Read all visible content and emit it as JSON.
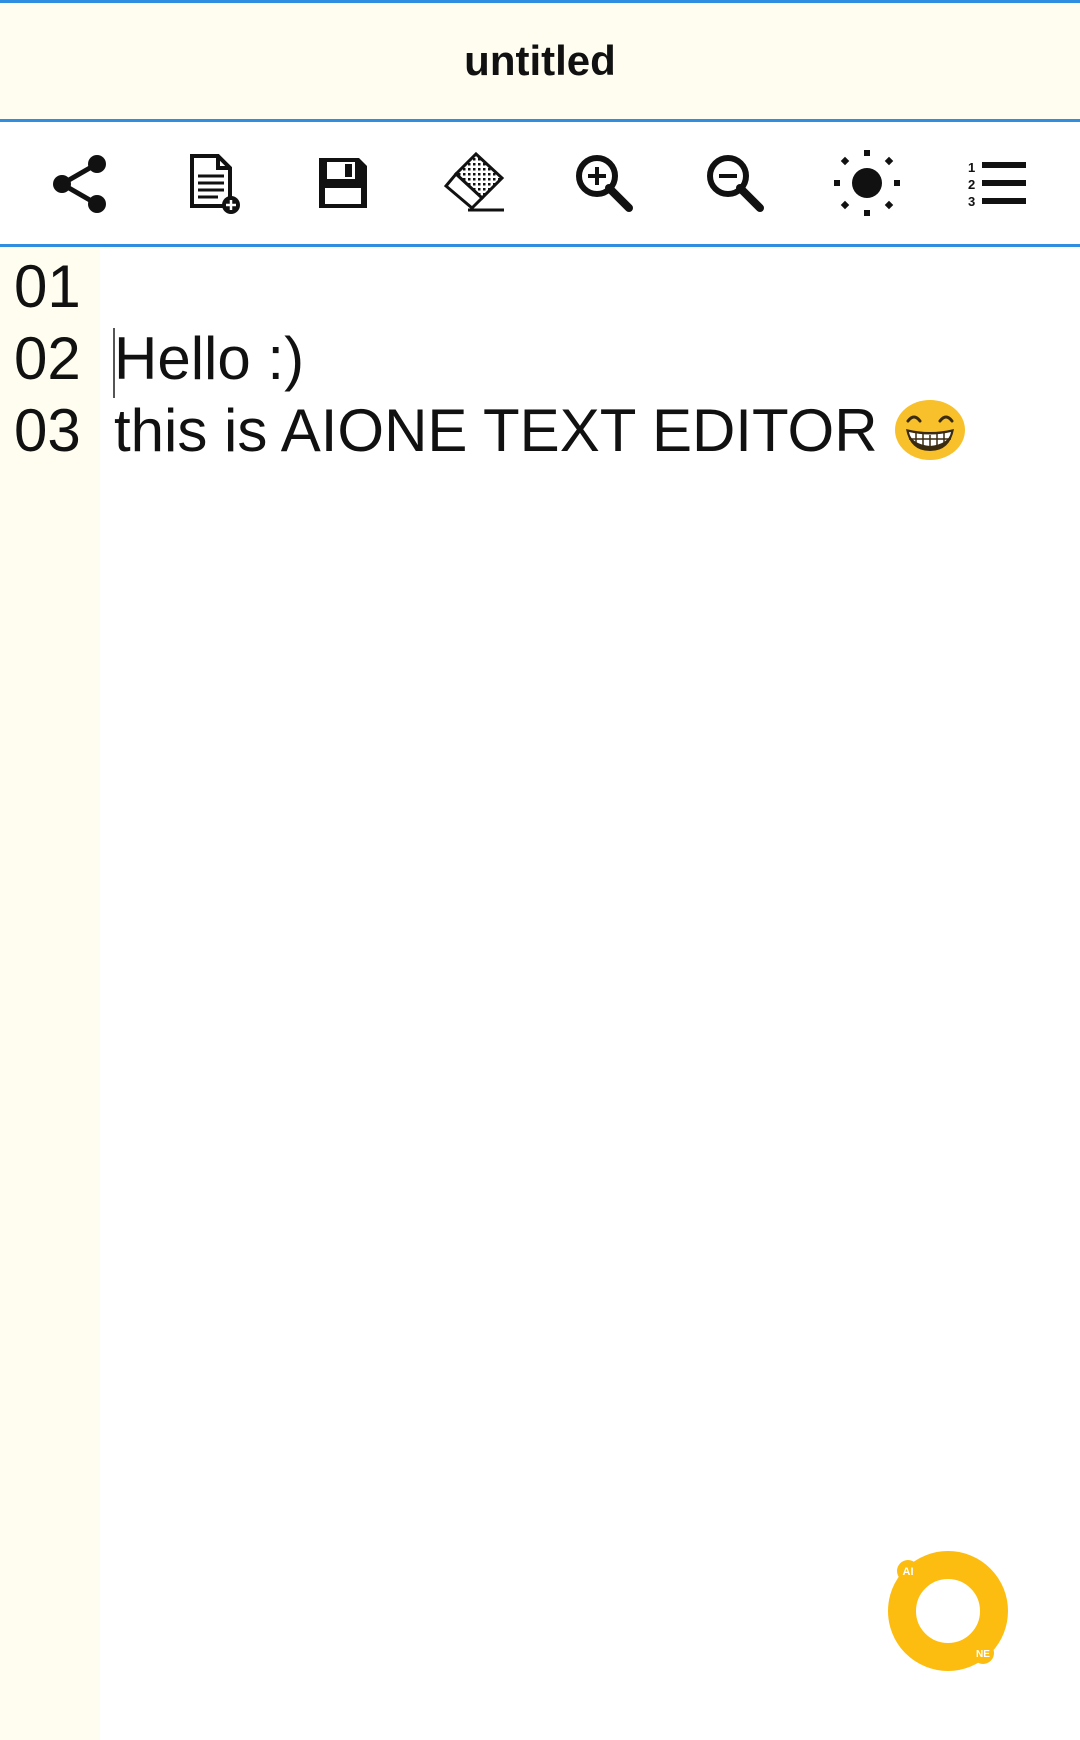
{
  "app": {
    "title": "untitled"
  },
  "toolbar": {
    "items": [
      {
        "name": "share",
        "icon": "share-icon"
      },
      {
        "name": "new-file",
        "icon": "new-file-icon"
      },
      {
        "name": "save",
        "icon": "save-icon"
      },
      {
        "name": "clear",
        "icon": "eraser-icon"
      },
      {
        "name": "zoom-in",
        "icon": "zoom-in-icon"
      },
      {
        "name": "zoom-out",
        "icon": "zoom-out-icon"
      },
      {
        "name": "theme",
        "icon": "brightness-icon"
      },
      {
        "name": "line-numbers",
        "icon": "numbered-list-icon"
      }
    ]
  },
  "editor": {
    "lines": [
      {
        "number": "01",
        "text": ""
      },
      {
        "number": "02",
        "text": "Hello :)"
      },
      {
        "number": "03",
        "text": "this is AIONE TEXT EDITOR",
        "emoji": "grinning-face-emoji"
      }
    ]
  },
  "fab": {
    "icon": "aione-logo-icon",
    "badge_top": "AI",
    "badge_bottom": "NE"
  },
  "colors": {
    "accent": "#2f8ee0",
    "header_bg": "#fffdf0",
    "gutter_bg": "#fffdf0",
    "fab": "#fdbd10"
  }
}
